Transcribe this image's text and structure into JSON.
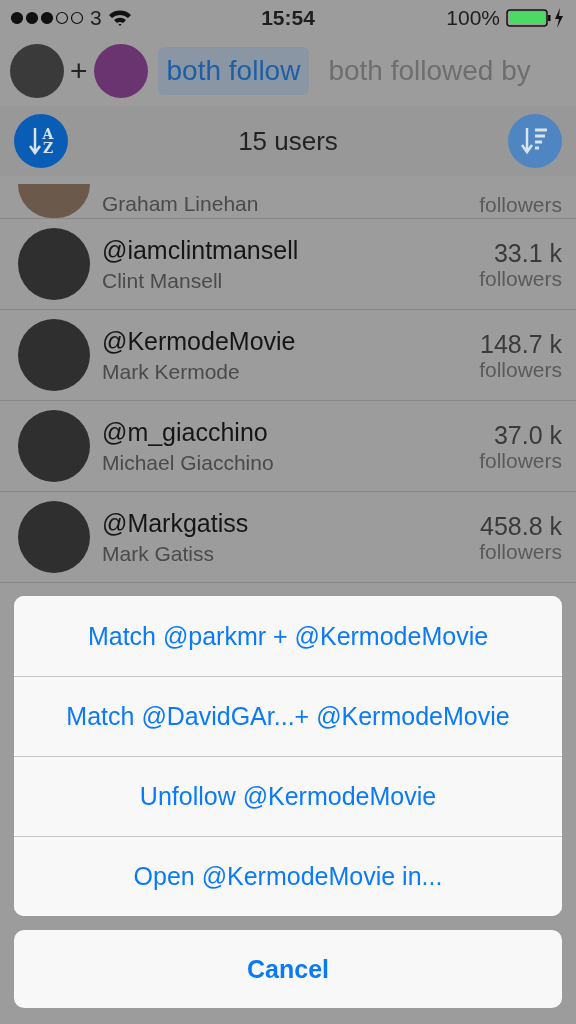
{
  "status_bar": {
    "carrier": "3",
    "time": "15:54",
    "battery": "100%"
  },
  "header": {
    "plus": "+",
    "segments": [
      {
        "label": "both follow",
        "selected": true
      },
      {
        "label": "both followed by",
        "selected": false
      }
    ]
  },
  "toolbar": {
    "sort_alpha": {
      "letters": [
        "A",
        "Z"
      ],
      "selected": true
    },
    "count": "15 users",
    "sort_followers": {
      "selected": false
    }
  },
  "users": [
    {
      "kind": "partial",
      "name": "Graham Linehan",
      "unit": "followers"
    },
    {
      "kind": "full",
      "handle": "@iamclintmansell",
      "name": "Clint Mansell",
      "count": "33.1 k",
      "unit": "followers"
    },
    {
      "kind": "full",
      "handle": "@KermodeMovie",
      "name": "Mark Kermode",
      "count": "148.7 k",
      "unit": "followers"
    },
    {
      "kind": "full",
      "handle": "@m_giacchino",
      "name": "Michael Giacchino",
      "count": "37.0 k",
      "unit": "followers"
    },
    {
      "kind": "full",
      "handle": "@Markgatiss",
      "name": "Mark Gatiss",
      "count": "458.8 k",
      "unit": "followers"
    }
  ],
  "action_sheet": {
    "actions": [
      "Match @parkmr + @KermodeMovie",
      "Match @DavidGAr...+ @KermodeMovie",
      "Unfollow @KermodeMovie",
      "Open @KermodeMovie in..."
    ],
    "cancel": "Cancel"
  }
}
